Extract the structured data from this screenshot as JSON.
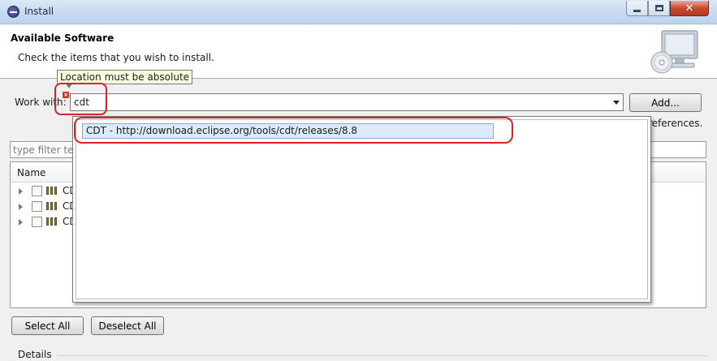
{
  "window": {
    "title": "Install",
    "icon": "eclipse-icon",
    "controls": {
      "minimize": "minimize-icon",
      "maximize": "maximize-icon",
      "close": "close-icon"
    }
  },
  "header": {
    "title": "Available Software",
    "description": "Check the items that you wish to install.",
    "illustration": "computer-cd-icon"
  },
  "work_with": {
    "label": "Work with:",
    "value": "cdt",
    "error_tooltip": "Location must be absolute",
    "error_icon": "error-icon",
    "add_button": "Add...",
    "dropdown_items": [
      "CDT - http://download.eclipse.org/tools/cdt/releases/8.8"
    ],
    "preferences_link_visible": "references."
  },
  "filter": {
    "placeholder": "type filter text",
    "visible_placeholder": "type filter tex"
  },
  "tree": {
    "column": "Name",
    "rows": [
      {
        "label": "CD",
        "checked": false
      },
      {
        "label": "CD",
        "checked": false
      },
      {
        "label": "CD",
        "checked": false
      }
    ]
  },
  "buttons": {
    "select_all": "Select All",
    "deselect_all": "Deselect All"
  },
  "details": {
    "label": "Details"
  },
  "colors": {
    "annotation": "#d2272a",
    "selection": "#dcebfc",
    "tooltip_bg": "#ffffe1"
  }
}
